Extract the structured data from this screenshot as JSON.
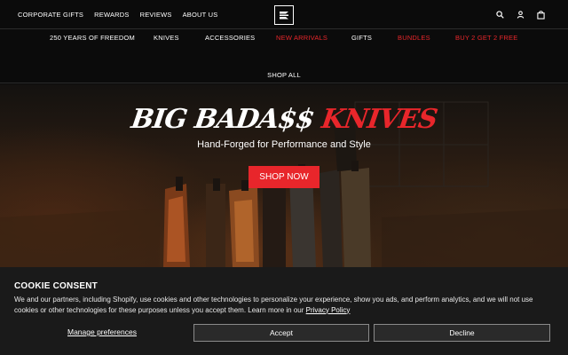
{
  "header": {
    "top_links": [
      {
        "label": "CORPORATE GIFTS"
      },
      {
        "label": "REWARDS"
      },
      {
        "label": "REVIEWS"
      },
      {
        "label": "ABOUT US"
      }
    ],
    "icons": [
      "search-icon",
      "account-icon",
      "cart-icon"
    ]
  },
  "nav": {
    "items": [
      {
        "label": "250 YEARS OF FREEDOM",
        "highlight": false
      },
      {
        "label": "KNIVES",
        "highlight": false
      },
      {
        "label": "ACCESSORIES",
        "highlight": false
      },
      {
        "label": "NEW ARRIVALS",
        "highlight": true
      },
      {
        "label": "GIFTS",
        "highlight": false
      },
      {
        "label": "BUNDLES",
        "highlight": true
      },
      {
        "label": "BUY 2 GET 2 FREE",
        "highlight": true
      }
    ],
    "shop_all": "SHOP ALL"
  },
  "hero": {
    "title_white": "BIG BADA$$",
    "title_red": "KNIVES",
    "subtitle": "Hand-Forged for Performance and Style",
    "cta": "SHOP NOW"
  },
  "cookie": {
    "title": "COOKIE CONSENT",
    "text": "We and our partners, including Shopify, use cookies and other technologies to personalize your experience, show you ads, and perform analytics, and we will not use cookies or other technologies for these purposes unless you accept them. Learn more in our ",
    "policy_link": "Privacy Policy",
    "manage": "Manage preferences",
    "accept": "Accept",
    "decline": "Decline"
  },
  "colors": {
    "accent_red": "#e8262b",
    "background": "#0b0b0b",
    "banner": "#1a1a1a"
  }
}
